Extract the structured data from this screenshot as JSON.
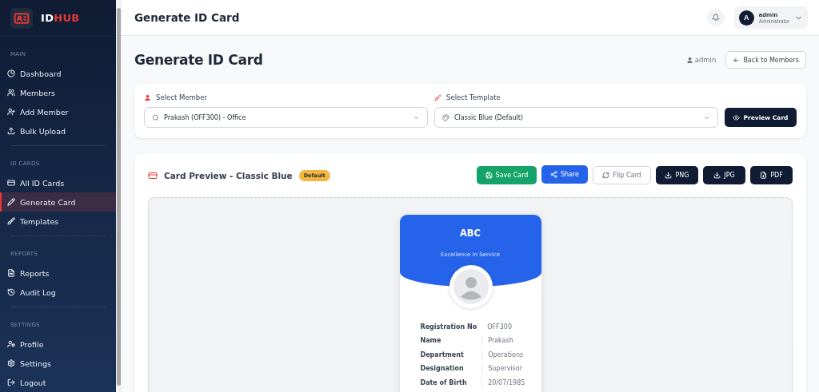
{
  "brand": {
    "prefix": "ID",
    "suffix": "HUB"
  },
  "sidebar": {
    "sections": [
      {
        "title": "MAIN",
        "items": [
          {
            "label": "Dashboard",
            "selected": false
          },
          {
            "label": "Members",
            "selected": false
          },
          {
            "label": "Add Member",
            "selected": false
          },
          {
            "label": "Bulk Upload",
            "selected": false
          }
        ]
      },
      {
        "title": "ID CARDS",
        "items": [
          {
            "label": "All ID Cards",
            "selected": false
          },
          {
            "label": "Generate Card",
            "selected": true
          },
          {
            "label": "Templates",
            "selected": false
          }
        ]
      },
      {
        "title": "REPORTS",
        "items": [
          {
            "label": "Reports",
            "selected": false
          },
          {
            "label": "Audit Log",
            "selected": false
          }
        ]
      },
      {
        "title": "SETTINGS",
        "items": [
          {
            "label": "Profile",
            "selected": false
          },
          {
            "label": "Settings",
            "selected": false
          },
          {
            "label": "Logout",
            "selected": false
          }
        ]
      }
    ]
  },
  "header": {
    "title": "Generate ID Card",
    "user": {
      "initial": "A",
      "name": "admin",
      "role": "Administrator"
    }
  },
  "page": {
    "title": "Generate ID Card",
    "user": "admin",
    "back_button": "Back to Members"
  },
  "selectors": {
    "member": {
      "label": "Select Member",
      "value": "Prakash (OFF300) - Office"
    },
    "template": {
      "label": "Select Template",
      "value": "Classic Blue (Default)"
    },
    "preview_button": "Preview Card"
  },
  "preview": {
    "title": "Card Preview - Classic Blue",
    "badge": "Default",
    "actions": [
      {
        "label": "Save Card",
        "kind": "success"
      },
      {
        "label": "Share",
        "kind": "primary"
      },
      {
        "label": "Flip Card",
        "kind": "outline"
      },
      {
        "label": "PNG",
        "kind": "dark"
      },
      {
        "label": "JPG",
        "kind": "dark"
      },
      {
        "label": "PDF",
        "kind": "dark"
      }
    ],
    "card": {
      "org": "ABC",
      "tagline": "Excellence in Service",
      "fields": [
        {
          "label": "Registration No",
          "value": "OFF300"
        },
        {
          "label": "Name",
          "value": "Prakash"
        },
        {
          "label": "Department",
          "value": "Operations"
        },
        {
          "label": "Designation",
          "value": "Supervisor"
        },
        {
          "label": "Date of Birth",
          "value": "20/07/1985"
        }
      ]
    }
  }
}
